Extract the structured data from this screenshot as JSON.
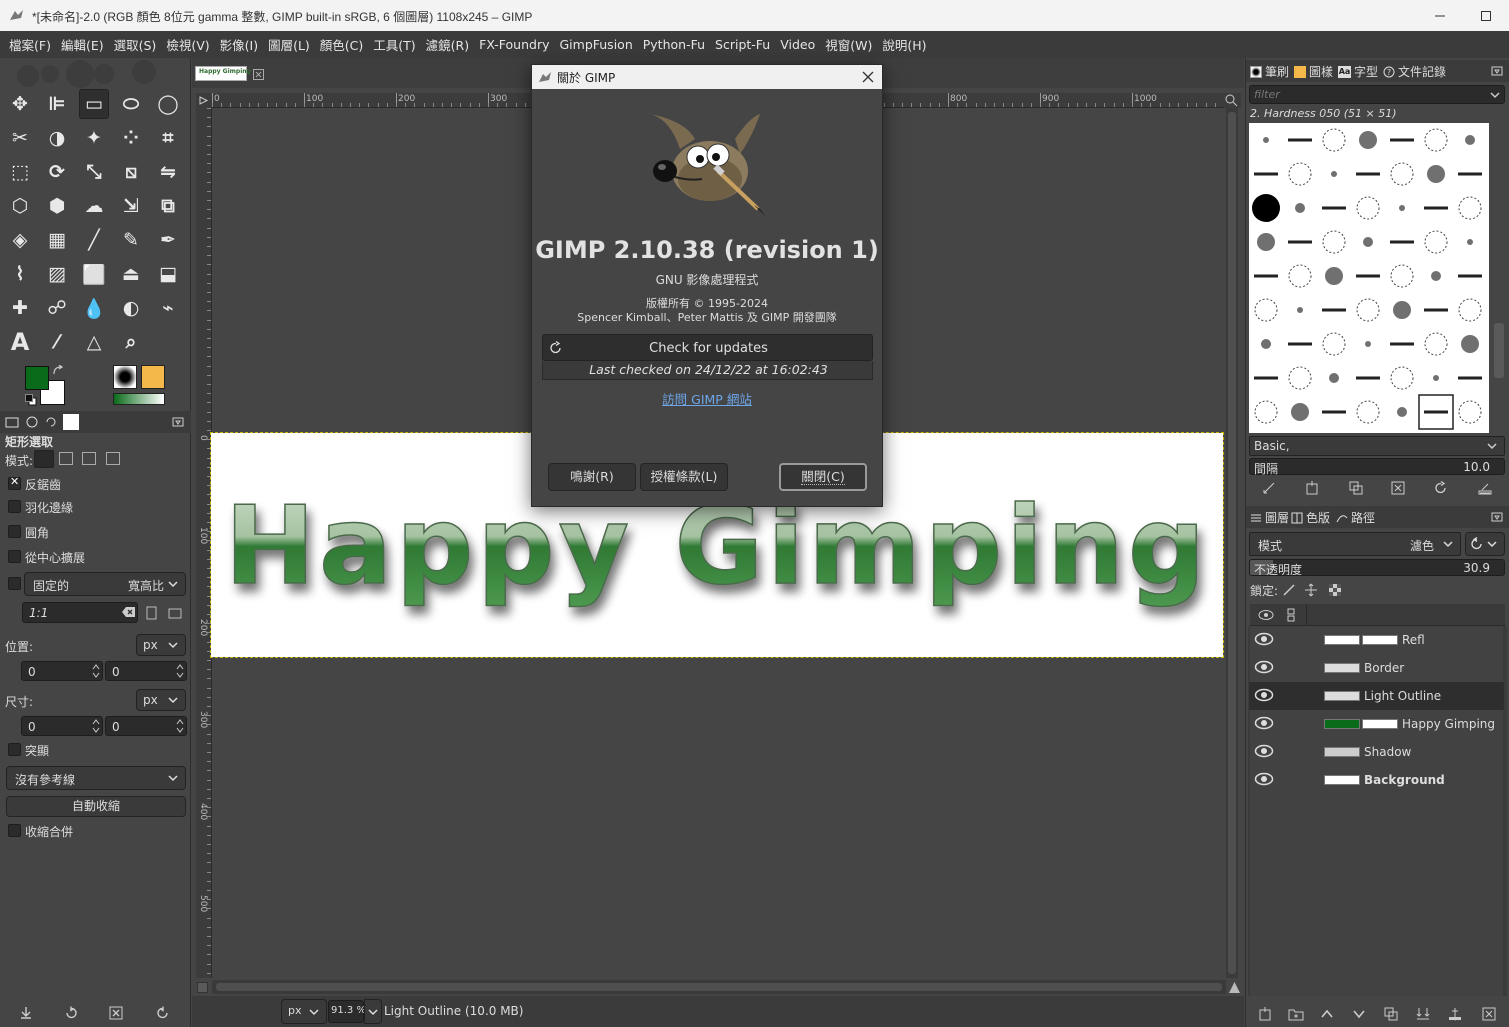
{
  "window": {
    "title": "*[未命名]-2.0 (RGB 顏色 8位元 gamma 整數, GIMP built-in sRGB, 6 個圖層) 1108x245 – GIMP"
  },
  "menubar": [
    "檔案(F)",
    "編輯(E)",
    "選取(S)",
    "檢視(V)",
    "影像(I)",
    "圖層(L)",
    "顏色(C)",
    "工具(T)",
    "濾鏡(R)",
    "FX-Foundry",
    "GimpFusion",
    "Python-Fu",
    "Script-Fu",
    "Video",
    "視窗(W)",
    "說明(H)"
  ],
  "colors": {
    "foreground": "#0a6b1a",
    "background": "#ffffff",
    "accent": "#3c7cc7"
  },
  "tool_options": {
    "title": "矩形選取",
    "mode_label": "模式:",
    "antialias": "反鋸齒",
    "feather": "羽化邊緣",
    "rounded": "圓角",
    "expand_center": "從中心擴展",
    "fixed": "固定的",
    "fixed_mode": "寬高比",
    "ratio_value": "1:1",
    "position_label": "位置:",
    "position_unit": "px",
    "pos_x": "0",
    "pos_y": "0",
    "size_label": "尺寸:",
    "size_unit": "px",
    "size_w": "0",
    "size_h": "0",
    "highlight": "突顯",
    "guides": "沒有參考線",
    "auto_shrink": "自動收縮",
    "shrink_merged": "收縮合併"
  },
  "image_tab": {
    "thumb_text": "Happy Gimping"
  },
  "rulers": {
    "h": [
      "0",
      "100",
      "200",
      "300",
      "800",
      "900",
      "1000"
    ],
    "v": [
      "0",
      "100",
      "200",
      "300",
      "400",
      "500"
    ]
  },
  "canvas": {
    "text": "Happy Gimping"
  },
  "statusbar": {
    "unit": "px",
    "zoom": "91.3 %",
    "message": "Light Outline (10.0 MB)"
  },
  "about": {
    "title": "關於 GIMP",
    "version": "GIMP 2.10.38 (revision 1)",
    "subtitle": "GNU 影像處理程式",
    "copyright": "版權所有 © 1995-2024",
    "authors": "Spencer Kimball、Peter Mattis 及 GIMP 開發團隊",
    "check_updates": "Check for updates",
    "last_checked": "Last checked on 24/12/22 at 16:02:43",
    "visit_link": "訪問 GIMP 網站",
    "credits_button": "鳴謝(R)",
    "license_button": "授權條款(L)",
    "close_button": "關閉(C)"
  },
  "brushes_dock": {
    "tabs": [
      "筆刷",
      "圖樣",
      "字型",
      "文件記錄"
    ],
    "filter_placeholder": "filter",
    "selected_brush": "2. Hardness 050 (51 × 51)",
    "tag": "Basic,",
    "spacing_label": "間隔",
    "spacing_value": "10.0"
  },
  "layers_dock": {
    "tabs": [
      "圖層",
      "色版",
      "路徑"
    ],
    "mode_label": "模式",
    "mode_value": "濾色",
    "opacity_label": "不透明度",
    "opacity_value": "30.9",
    "opacity_fraction": 0.309,
    "lock_label": "鎖定:",
    "layers": [
      {
        "name": "Refl",
        "selected": false,
        "bold": false
      },
      {
        "name": "Border",
        "selected": false,
        "bold": false
      },
      {
        "name": "Light Outline",
        "selected": true,
        "bold": false
      },
      {
        "name": "Happy Gimping",
        "selected": false,
        "bold": false
      },
      {
        "name": "Shadow",
        "selected": false,
        "bold": false
      },
      {
        "name": "Background",
        "selected": false,
        "bold": true
      }
    ]
  }
}
